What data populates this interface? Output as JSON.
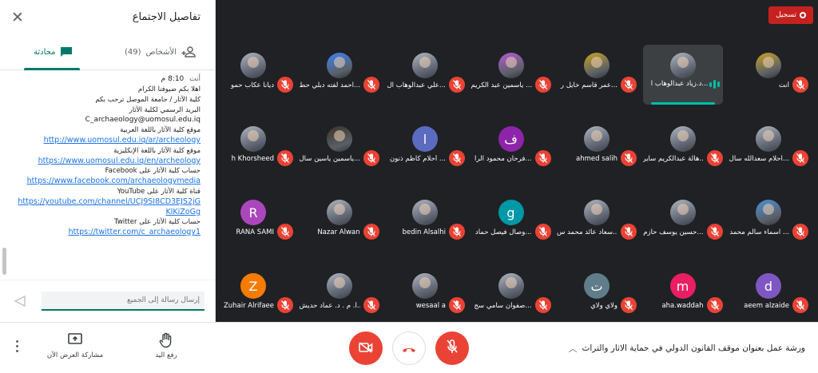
{
  "panel": {
    "title": "تفاصيل الاجتماع",
    "close_icon": "close-icon",
    "tabs": [
      {
        "label": "الأشخاص",
        "count": "(49)",
        "icon": "people-icon"
      },
      {
        "label": "محادثة",
        "icon": "chat-icon"
      }
    ],
    "message": {
      "sender": "أنت",
      "time": "8:10 م",
      "lines": [
        {
          "text": "اهلا بكم ضيوفنا الكرام",
          "kind": "ar"
        },
        {
          "text": "كلية الآثار / جامعة الموصل ترحب بكم",
          "kind": "ar"
        },
        {
          "text": "البريد الرسمي لكلية الآثار",
          "kind": "ar"
        },
        {
          "text": "C_archaeology@uomosul.edu.iq",
          "kind": "en"
        },
        {
          "text": "موقع كلية الآثار باللغة العربية",
          "kind": "ar"
        },
        {
          "text": "http://www.uomosul.edu.iq/ar/archeology",
          "kind": "link"
        },
        {
          "text": "موقع كلية الآثار باللغة الإنكليزية",
          "kind": "ar"
        },
        {
          "text": "https://www.uomosul.edu.iq/en/archeology",
          "kind": "link"
        },
        {
          "text": "حساب كلية الآثار على Facebook",
          "kind": "ar"
        },
        {
          "text": "https://www.facebook.com/archaeologymedia",
          "kind": "link"
        },
        {
          "text": "قناة كلية الآثار على YouTube",
          "kind": "ar"
        },
        {
          "text": "https://youtube.com/channel/UCJ9SI8CD3EJS2jG",
          "kind": "link"
        },
        {
          "text": "KlKiZoGg",
          "kind": "link"
        },
        {
          "text": "حساب كلية الآثار على Twitter",
          "kind": "ar"
        },
        {
          "text": "https://twitter.com/c_archaeology1",
          "kind": "link"
        }
      ]
    },
    "composer": {
      "placeholder": "إرسال رسالة إلى الجميع",
      "send_icon": "send-icon"
    }
  },
  "recording": {
    "label": "تسجيل",
    "color": "#c5221f"
  },
  "participants": [
    {
      "row": 0,
      "col": 0,
      "name": "أنت",
      "avatar": "photo",
      "color": "#c9a227"
    },
    {
      "row": 0,
      "col": 1,
      "name": "د.زياد عبدالوهاب ا...",
      "avatar": "photo",
      "speaking": true
    },
    {
      "row": 0,
      "col": 2,
      "name": "عمر قاسم خايل ر...",
      "avatar": "photo",
      "color": "#c9a227"
    },
    {
      "row": 0,
      "col": 3,
      "name": "ياسمين عبد الكريم ...",
      "avatar": "photo",
      "color": "#b55bd6"
    },
    {
      "row": 0,
      "col": 4,
      "name": "علي عبدالوهاب ال...",
      "avatar": "photo"
    },
    {
      "row": 0,
      "col": 5,
      "name": "احمد لفته دبلي حط...",
      "avatar": "photo",
      "color": "#3b82f6"
    },
    {
      "row": 0,
      "col": 6,
      "name": "ديانا عكاب حمو",
      "avatar": "photo"
    },
    {
      "row": 1,
      "col": 0,
      "name": "احلام سعدالله سال...",
      "avatar": "photo"
    },
    {
      "row": 1,
      "col": 1,
      "name": "هالة عبدالكريم ساير...",
      "avatar": "photo"
    },
    {
      "row": 1,
      "col": 2,
      "name": "ahmed salih",
      "avatar": "photo"
    },
    {
      "row": 1,
      "col": 3,
      "name": "فرحان محمود الرا...",
      "avatar": "letter",
      "letter": "ف",
      "color": "#8e24aa"
    },
    {
      "row": 1,
      "col": 4,
      "name": "أحلام كاظم ذنون ...",
      "avatar": "letter",
      "letter": "ا",
      "color": "#5c6bc0"
    },
    {
      "row": 1,
      "col": 5,
      "name": "ياسمين ياسين سال...",
      "avatar": "photo",
      "color": "#3a3226"
    },
    {
      "row": 1,
      "col": 6,
      "name": "h Khorsheed",
      "avatar": "photo"
    },
    {
      "row": 2,
      "col": 0,
      "name": "اسماء سالم محمد ...",
      "avatar": "photo",
      "color": "#4a90d9"
    },
    {
      "row": 2,
      "col": 1,
      "name": "حسين يوسف حازم...",
      "avatar": "photo"
    },
    {
      "row": 2,
      "col": 2,
      "name": "سعاد عائد محمد س...",
      "avatar": "photo"
    },
    {
      "row": 2,
      "col": 3,
      "name": "وصال فيصل حماد...",
      "avatar": "letter",
      "letter": "g",
      "color": "#0097a7"
    },
    {
      "row": 2,
      "col": 4,
      "name": "bedin Alsalhi",
      "avatar": "photo"
    },
    {
      "row": 2,
      "col": 5,
      "name": "Nazar Alwan",
      "avatar": "photo"
    },
    {
      "row": 2,
      "col": 6,
      "name": "RANA SAMI",
      "avatar": "letter",
      "letter": "R",
      "color": "#ab47bc"
    },
    {
      "row": 3,
      "col": 0,
      "name": "aeem alzaide",
      "avatar": "letter",
      "letter": "d",
      "color": "#7e57c2"
    },
    {
      "row": 3,
      "col": 1,
      "name": "aha.waddah",
      "avatar": "letter",
      "letter": "m",
      "color": "#e91e63"
    },
    {
      "row": 3,
      "col": 2,
      "name": "ولاي ولاي",
      "avatar": "letter",
      "letter": "ت",
      "color": "#607d8b"
    },
    {
      "row": 3,
      "col": 3,
      "name": "صفوان سامي سج...",
      "avatar": "photo"
    },
    {
      "row": 3,
      "col": 4,
      "name": "wesaal a",
      "avatar": "photo"
    },
    {
      "row": 3,
      "col": 5,
      "name": "أ. م . د. عماد حديش...",
      "avatar": "photo"
    },
    {
      "row": 3,
      "col": 6,
      "name": "Zuhair Alrifaee",
      "avatar": "letter",
      "letter": "Z",
      "color": "#f57c00"
    }
  ],
  "bottom": {
    "meeting_title": "ورشة عمل بعنوان موقف القانون الدولي في حماية الاثار والتراث",
    "chevron_icon": "chevron-up-icon",
    "camera_off_icon": "camera-off-icon",
    "hangup_icon": "hangup-icon",
    "mic_off_icon": "mic-off-icon",
    "raise_hand": "رفع اليد",
    "present_now": "مشاركة العرض الآن",
    "more_icon": "more-vert-icon",
    "accent_red": "#ea4335"
  }
}
